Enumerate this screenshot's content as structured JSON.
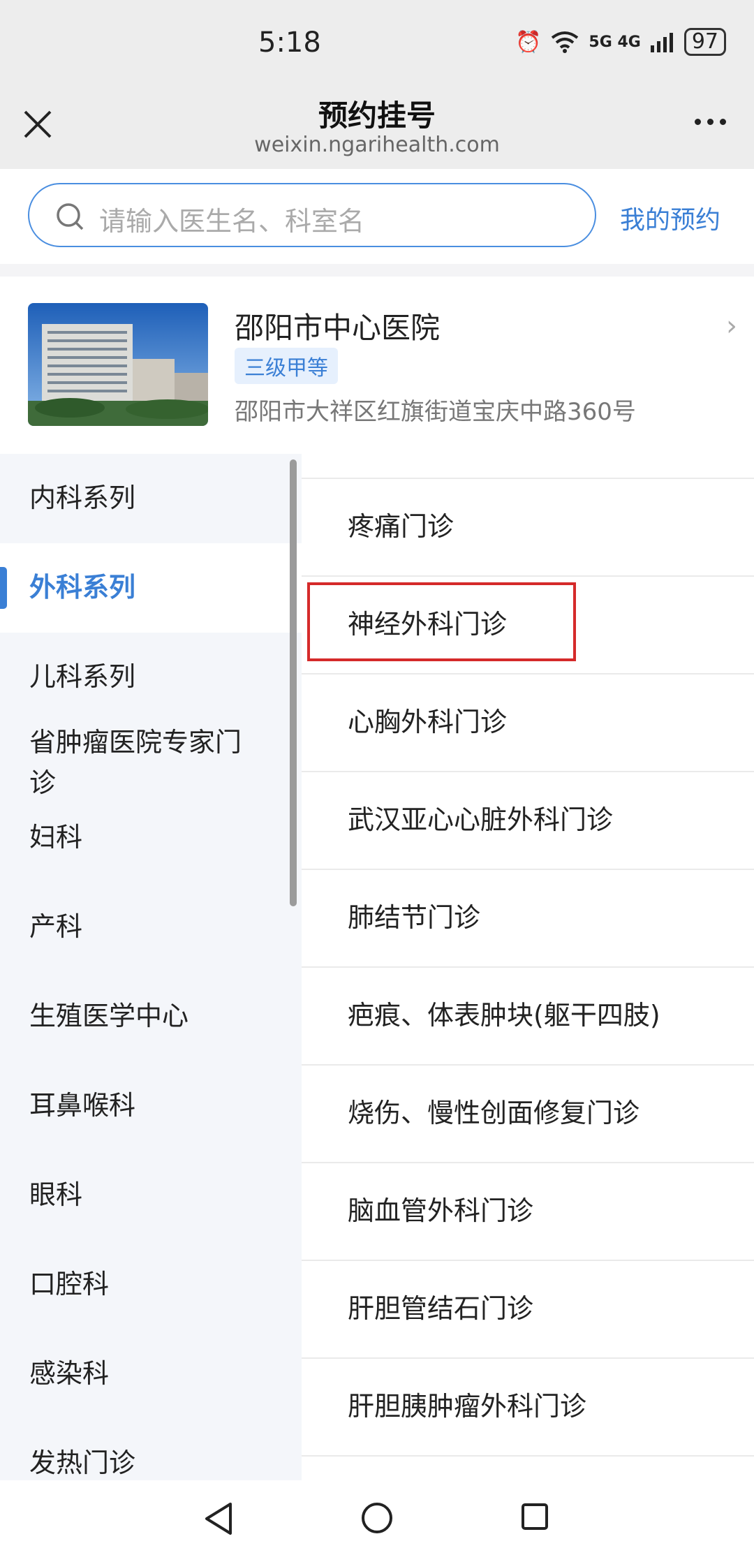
{
  "status_bar": {
    "time": "5:18",
    "network": "5G 4G",
    "battery": "97"
  },
  "nav": {
    "title": "预约挂号",
    "subtitle": "weixin.ngarihealth.com"
  },
  "search": {
    "placeholder": "请输入医生名、科室名",
    "my_appointments": "我的预约"
  },
  "hospital": {
    "name": "邵阳市中心医院",
    "level": "三级甲等",
    "address": "邵阳市大祥区红旗街道宝庆中路360号"
  },
  "categories": [
    {
      "label": "内科系列"
    },
    {
      "label": "外科系列",
      "active": true
    },
    {
      "label": "儿科系列"
    },
    {
      "label": "省肿瘤医院专家门诊"
    },
    {
      "label": "妇科"
    },
    {
      "label": "产科"
    },
    {
      "label": "生殖医学中心"
    },
    {
      "label": "耳鼻喉科"
    },
    {
      "label": "眼科"
    },
    {
      "label": "口腔科"
    },
    {
      "label": "感染科"
    },
    {
      "label": "发热门诊"
    }
  ],
  "departments": [
    {
      "label": "疼痛门诊"
    },
    {
      "label": "神经外科门诊",
      "highlighted": true
    },
    {
      "label": "心胸外科门诊"
    },
    {
      "label": "武汉亚心心脏外科门诊"
    },
    {
      "label": "肺结节门诊"
    },
    {
      "label": "疤痕、体表肿块(躯干四肢)"
    },
    {
      "label": "烧伤、慢性创面修复门诊"
    },
    {
      "label": "脑血管外科门诊"
    },
    {
      "label": "肝胆管结石门诊"
    },
    {
      "label": "肝胆胰肿瘤外科门诊"
    }
  ],
  "colors": {
    "accent": "#3a7fd5",
    "highlight_border": "#d52a2a",
    "sidebar_bg": "#f4f6fa"
  }
}
